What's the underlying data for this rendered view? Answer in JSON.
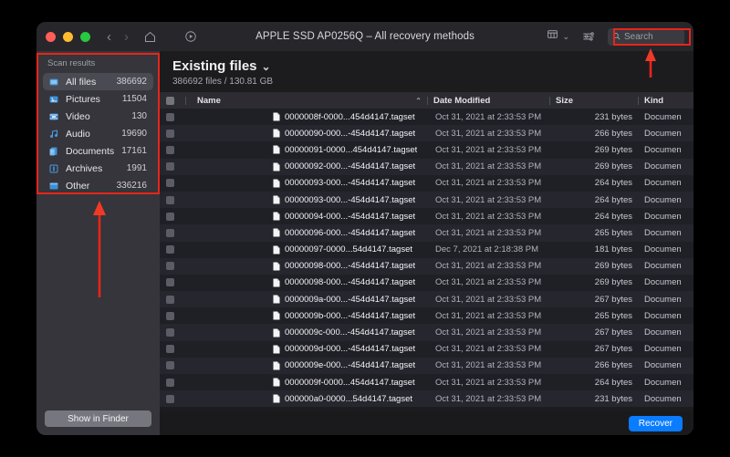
{
  "window": {
    "title": "APPLE SSD AP0256Q – All recovery methods",
    "traffic_lights": [
      "close",
      "minimize",
      "maximize"
    ],
    "colors": {
      "close": "#ff5f57",
      "minimize": "#febc2e",
      "maximize": "#28c840",
      "accent": "#0a7cff",
      "annotation": "#e8251b"
    }
  },
  "toolbar": {
    "back_icon": "chevron-left-icon",
    "forward_icon": "chevron-right-icon",
    "home_icon": "home-icon",
    "play_icon": "play-circle-icon",
    "view_icon": "grid-view-icon",
    "view_chevron": "⌄",
    "filter_icon": "filter-sliders-icon",
    "search_icon": "search-icon",
    "search_placeholder": "Search",
    "search_value": ""
  },
  "sidebar": {
    "title": "Scan results",
    "items": [
      {
        "label": "All files",
        "count": "386692",
        "icon": "all-files-icon",
        "selected": true
      },
      {
        "label": "Pictures",
        "count": "11504",
        "icon": "pictures-icon",
        "selected": false
      },
      {
        "label": "Video",
        "count": "130",
        "icon": "video-icon",
        "selected": false
      },
      {
        "label": "Audio",
        "count": "19690",
        "icon": "audio-icon",
        "selected": false
      },
      {
        "label": "Documents",
        "count": "17161",
        "icon": "documents-icon",
        "selected": false
      },
      {
        "label": "Archives",
        "count": "1991",
        "icon": "archives-icon",
        "selected": false
      },
      {
        "label": "Other",
        "count": "336216",
        "icon": "other-icon",
        "selected": false
      }
    ],
    "show_in_finder_label": "Show in Finder"
  },
  "main": {
    "title": "Existing files",
    "title_chevron": "⌄",
    "subtitle": "386692 files / 130.81 GB"
  },
  "table": {
    "columns": [
      "Name",
      "Date Modified",
      "Size",
      "Kind"
    ],
    "sort_indicator": "⌃",
    "rows": [
      {
        "name": "0000008f-0000...454d4147.tagset",
        "date": "Oct 31, 2021 at 2:33:53 PM",
        "size": "231 bytes",
        "kind": "Documen"
      },
      {
        "name": "00000090-000...-454d4147.tagset",
        "date": "Oct 31, 2021 at 2:33:53 PM",
        "size": "266 bytes",
        "kind": "Documen"
      },
      {
        "name": "00000091-0000...454d4147.tagset",
        "date": "Oct 31, 2021 at 2:33:53 PM",
        "size": "269 bytes",
        "kind": "Documen"
      },
      {
        "name": "00000092-000...-454d4147.tagset",
        "date": "Oct 31, 2021 at 2:33:53 PM",
        "size": "269 bytes",
        "kind": "Documen"
      },
      {
        "name": "00000093-000...-454d4147.tagset",
        "date": "Oct 31, 2021 at 2:33:53 PM",
        "size": "264 bytes",
        "kind": "Documen"
      },
      {
        "name": "00000093-000...-454d4147.tagset",
        "date": "Oct 31, 2021 at 2:33:53 PM",
        "size": "264 bytes",
        "kind": "Documen"
      },
      {
        "name": "00000094-000...-454d4147.tagset",
        "date": "Oct 31, 2021 at 2:33:53 PM",
        "size": "264 bytes",
        "kind": "Documen"
      },
      {
        "name": "00000096-000...-454d4147.tagset",
        "date": "Oct 31, 2021 at 2:33:53 PM",
        "size": "265 bytes",
        "kind": "Documen"
      },
      {
        "name": "00000097-0000...54d4147.tagset",
        "date": "Dec 7, 2021 at 2:18:38 PM",
        "size": "181 bytes",
        "kind": "Documen"
      },
      {
        "name": "00000098-000...-454d4147.tagset",
        "date": "Oct 31, 2021 at 2:33:53 PM",
        "size": "269 bytes",
        "kind": "Documen"
      },
      {
        "name": "00000098-000...-454d4147.tagset",
        "date": "Oct 31, 2021 at 2:33:53 PM",
        "size": "269 bytes",
        "kind": "Documen"
      },
      {
        "name": "0000009a-000...-454d4147.tagset",
        "date": "Oct 31, 2021 at 2:33:53 PM",
        "size": "267 bytes",
        "kind": "Documen"
      },
      {
        "name": "0000009b-000...-454d4147.tagset",
        "date": "Oct 31, 2021 at 2:33:53 PM",
        "size": "265 bytes",
        "kind": "Documen"
      },
      {
        "name": "0000009c-000...-454d4147.tagset",
        "date": "Oct 31, 2021 at 2:33:53 PM",
        "size": "267 bytes",
        "kind": "Documen"
      },
      {
        "name": "0000009d-000...-454d4147.tagset",
        "date": "Oct 31, 2021 at 2:33:53 PM",
        "size": "267 bytes",
        "kind": "Documen"
      },
      {
        "name": "0000009e-000...-454d4147.tagset",
        "date": "Oct 31, 2021 at 2:33:53 PM",
        "size": "266 bytes",
        "kind": "Documen"
      },
      {
        "name": "0000009f-0000...454d4147.tagset",
        "date": "Oct 31, 2021 at 2:33:53 PM",
        "size": "264 bytes",
        "kind": "Documen"
      },
      {
        "name": "000000a0-0000...54d4147.tagset",
        "date": "Oct 31, 2021 at 2:33:53 PM",
        "size": "231 bytes",
        "kind": "Documen"
      }
    ]
  },
  "footer": {
    "recover_label": "Recover"
  }
}
